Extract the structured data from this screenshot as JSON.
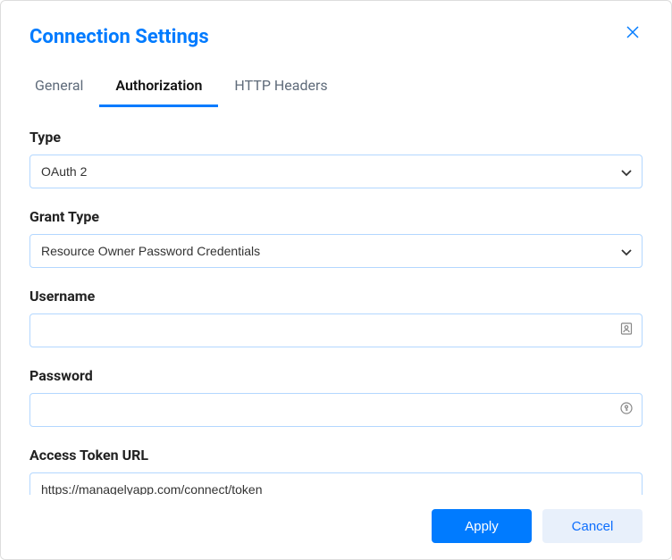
{
  "dialog": {
    "title": "Connection Settings"
  },
  "tabs": [
    {
      "label": "General"
    },
    {
      "label": "Authorization"
    },
    {
      "label": "HTTP Headers"
    }
  ],
  "fields": {
    "type": {
      "label": "Type",
      "value": "OAuth 2"
    },
    "grant_type": {
      "label": "Grant Type",
      "value": "Resource Owner Password Credentials"
    },
    "username": {
      "label": "Username",
      "value": ""
    },
    "password": {
      "label": "Password",
      "value": ""
    },
    "access_token_url": {
      "label": "Access Token URL",
      "value": "https://managelyapp.com/connect/token"
    }
  },
  "footer": {
    "apply": "Apply",
    "cancel": "Cancel"
  }
}
